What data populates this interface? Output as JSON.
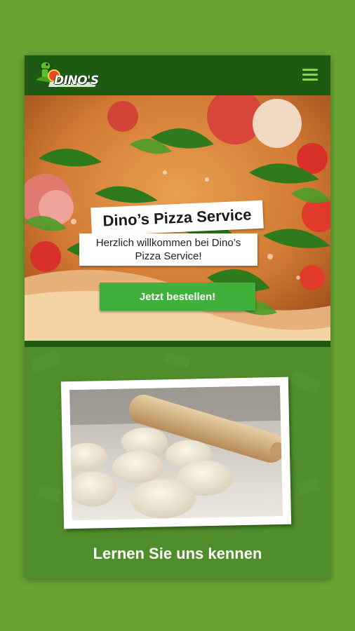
{
  "header": {
    "logo_text": "DINO'S",
    "menu_icon": "hamburger-menu-icon"
  },
  "hero": {
    "title": "Dino’s Pizza Service",
    "subtitle": "Herzlich willkommen bei Dino’s Pizza Service!",
    "cta_label": "Jetzt bestellen!"
  },
  "about": {
    "heading": "Lernen Sie uns kennen"
  },
  "colors": {
    "page_background": "#6aa534",
    "header_background": "#1f5a12",
    "menu_icon": "#8fd14e",
    "cta_button": "#3fb13a",
    "section_background": "#4f8e2b"
  }
}
